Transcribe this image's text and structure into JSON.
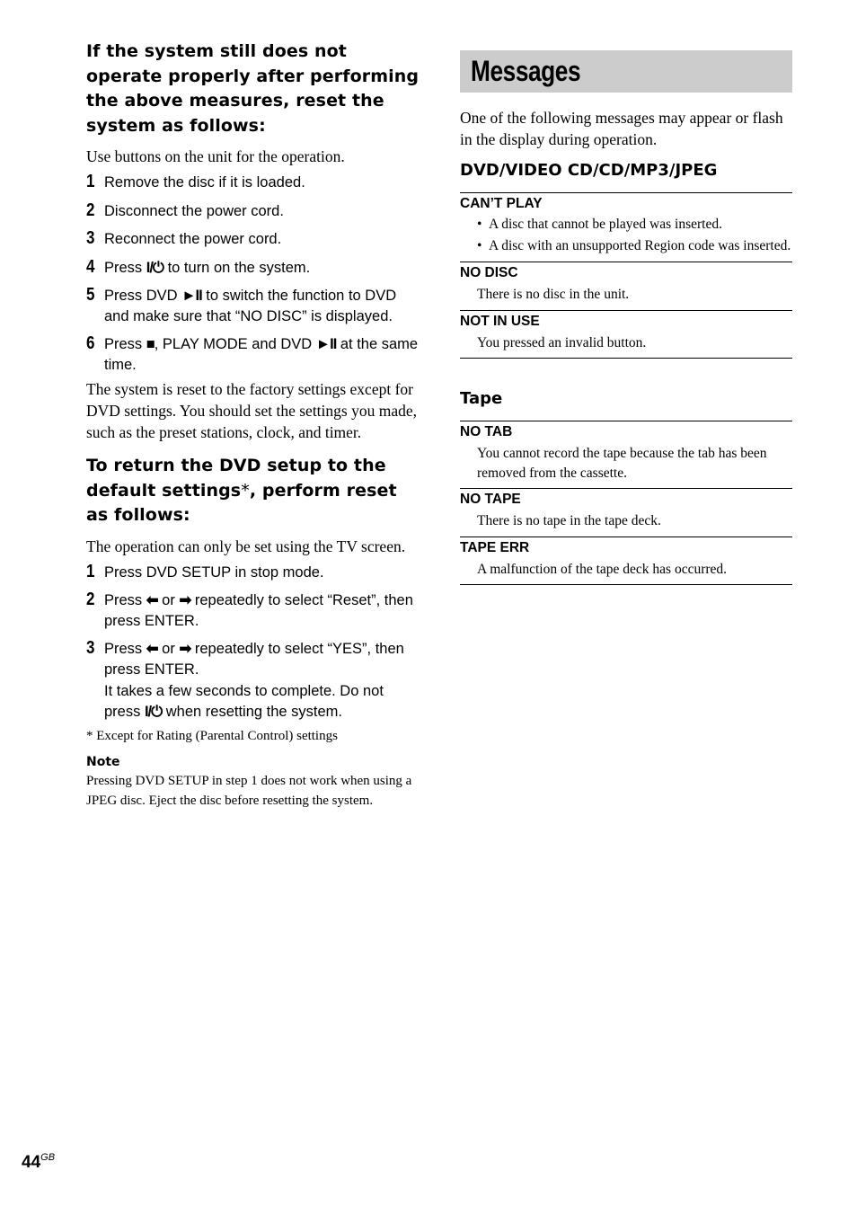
{
  "left": {
    "heading1": "If the system still does not operate properly after performing the above measures, reset the system as follows:",
    "intro1": "Use buttons on the unit for the operation.",
    "steps1": [
      {
        "num": "1",
        "pre": "Remove the disc if it is loaded.",
        "icon1": "",
        "mid": "",
        "icon2": "",
        "post": ""
      },
      {
        "num": "2",
        "pre": "Disconnect the power cord.",
        "icon1": "",
        "mid": "",
        "icon2": "",
        "post": ""
      },
      {
        "num": "3",
        "pre": "Reconnect the power cord.",
        "icon1": "",
        "mid": "",
        "icon2": "",
        "post": ""
      },
      {
        "num": "4",
        "pre": "Press ",
        "icon1": "I/⏻",
        "mid": " to turn on the system.",
        "icon2": "",
        "post": ""
      },
      {
        "num": "5",
        "pre": "Press DVD ",
        "icon1": "►II",
        "mid": " to switch the function to DVD and  make sure that “NO DISC” is displayed.",
        "icon2": "",
        "post": ""
      },
      {
        "num": "6",
        "pre": "Press ",
        "icon1": "■",
        "mid": ", PLAY MODE and DVD ",
        "icon2": "►II",
        "post": " at the same time."
      }
    ],
    "after1": "The system is reset to the factory settings except for DVD settings. You should set the settings you made, such as the preset stations, clock, and timer.",
    "heading2_a": "To return the DVD setup to the default settings",
    "heading2_star": "*",
    "heading2_b": ", perform reset as follows:",
    "intro2": "The operation can only be set using the TV screen.",
    "steps2": [
      {
        "num": "1",
        "pre": "Press DVD SETUP in stop mode.",
        "icon1": "",
        "mid": "",
        "icon2": "",
        "post": ""
      },
      {
        "num": "2",
        "pre": "Press ",
        "icon1": "⬅",
        "mid": " or ",
        "icon2": "➡",
        "post": " repeatedly to select “Reset”, then press ENTER."
      },
      {
        "num": "3",
        "pre": "Press ",
        "icon1": "⬅",
        "mid": " or ",
        "icon2": "➡",
        "post": " repeatedly to select “YES”, then press ENTER."
      }
    ],
    "step3_extra_pre": "It takes a few seconds to complete. Do not press ",
    "step3_extra_icon": "I/⏻",
    "step3_extra_post": " when resetting the system.",
    "footnote": "* Except for Rating (Parental Control) settings",
    "note_title": "Note",
    "note_text": "Pressing DVD SETUP in step 1 does not work when using a JPEG disc. Eject the disc before resetting the system."
  },
  "right": {
    "title": "Messages",
    "intro": "One of the following messages may appear or flash in the display during operation.",
    "section1_title": "DVD/VIDEO CD/CD/MP3/JPEG",
    "section1_items": [
      {
        "name": "CAN’T PLAY",
        "bullets": [
          "A disc that cannot be played was inserted.",
          "A disc with an unsupported Region code was inserted."
        ]
      },
      {
        "name": "NO DISC",
        "desc": "There is no disc in the unit."
      },
      {
        "name": "NOT IN USE",
        "desc": "You pressed an invalid button."
      }
    ],
    "section2_title": "Tape",
    "section2_items": [
      {
        "name": "NO TAB",
        "desc": "You cannot record the tape because the tab has been removed from the cassette."
      },
      {
        "name": "NO TAPE",
        "desc": "There is no tape in the tape deck."
      },
      {
        "name": "TAPE ERR",
        "desc": "A malfunction of the tape deck has occurred."
      }
    ]
  },
  "footer": {
    "page_number": "44",
    "page_suffix": "GB"
  },
  "colors": {
    "title_band": "#cccccc",
    "text": "#000000"
  }
}
